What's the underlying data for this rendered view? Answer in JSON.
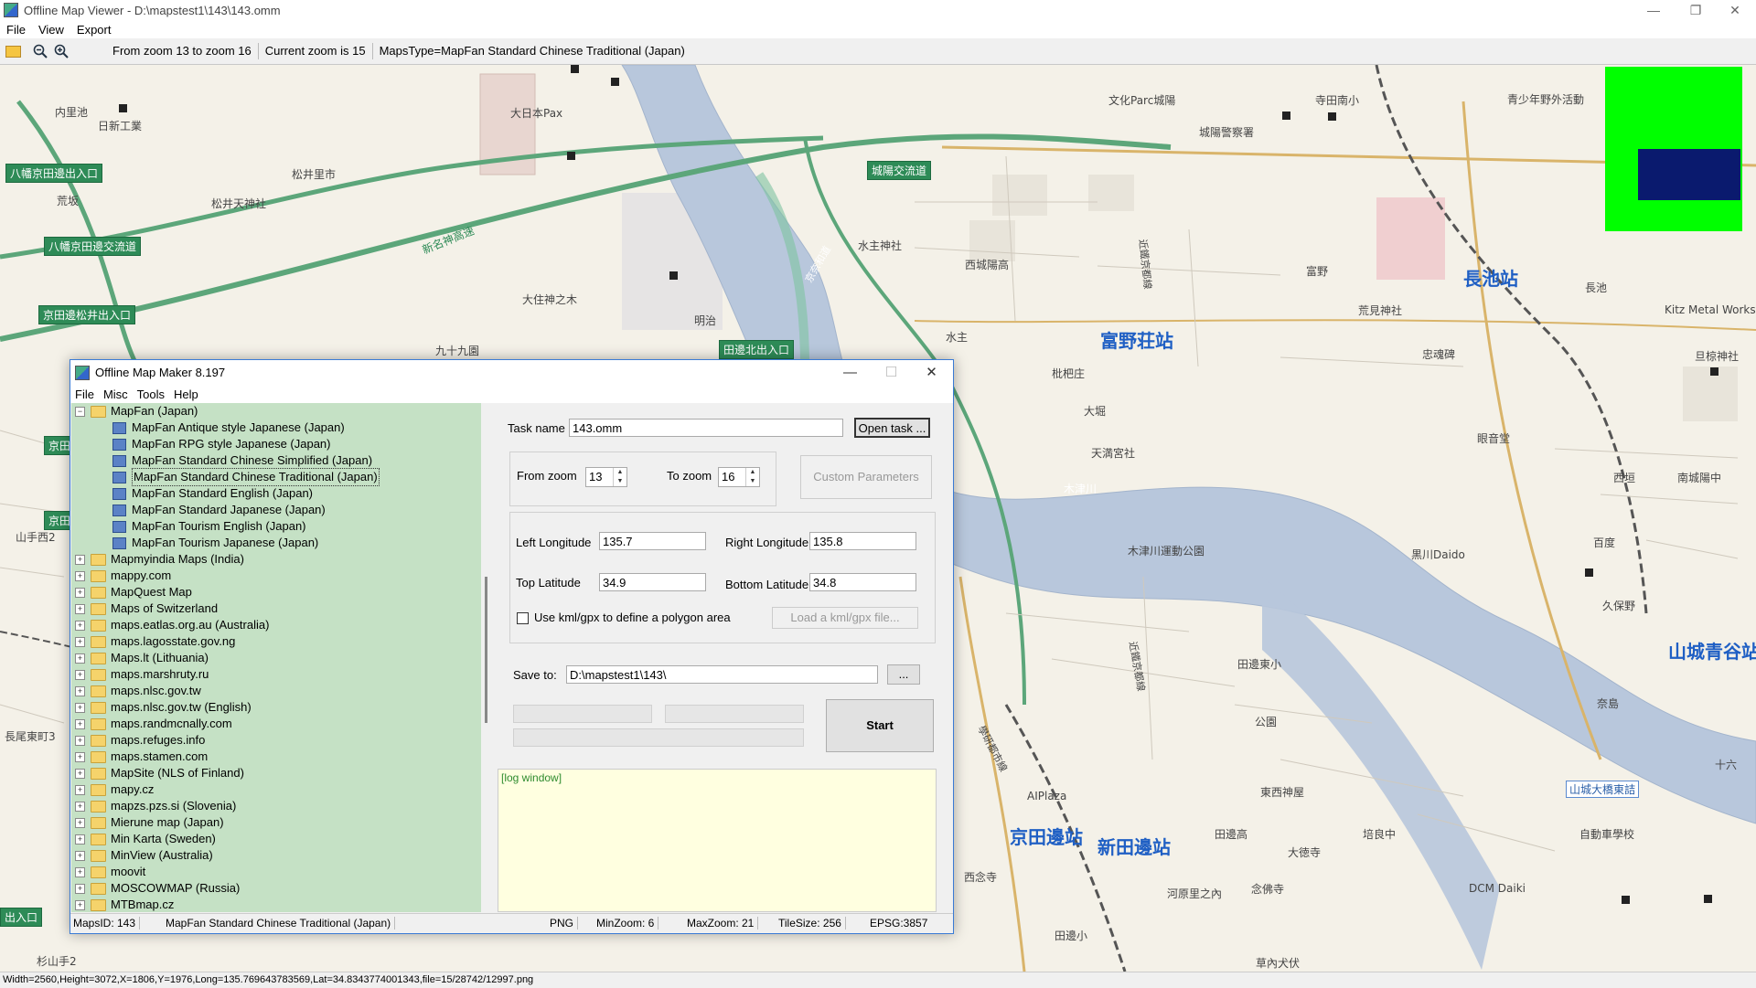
{
  "app": {
    "title": "Offline Map Viewer - D:\\mapstest1\\143\\143.omm",
    "menu": [
      "File",
      "View",
      "Export"
    ],
    "toolbar": {
      "zoom_range": "From zoom 13 to zoom 16",
      "current_zoom": "Current zoom is 15",
      "maps_type": "MapsType=MapFan Standard Chinese Traditional (Japan)"
    },
    "status": "Width=2560,Height=3072,X=1806,Y=1976,Long=135.769643783569,Lat=34.8343774001343,file=15/28742/12997.png"
  },
  "map_labels": [
    {
      "id": "l1",
      "text": "日新工業"
    },
    {
      "id": "l2",
      "text": "大日本Pax"
    },
    {
      "id": "l3",
      "text": "文化Parc城陽"
    },
    {
      "id": "l4",
      "text": "寺田南小"
    },
    {
      "id": "l5",
      "text": "青少年野外活動"
    },
    {
      "id": "l6",
      "text": "城陽警察署"
    },
    {
      "id": "l7",
      "text": "松井里市"
    },
    {
      "id": "l8",
      "text": "松井天神社"
    },
    {
      "id": "l9",
      "text": "新名神高速"
    },
    {
      "id": "l10",
      "text": "大住神之木"
    },
    {
      "id": "l11",
      "text": "明治"
    },
    {
      "id": "l12",
      "text": "九十九園"
    },
    {
      "id": "l13",
      "text": "水主神社"
    },
    {
      "id": "l14",
      "text": "西城陽高"
    },
    {
      "id": "l15",
      "text": "富野"
    },
    {
      "id": "l16",
      "text": "荒見神社"
    },
    {
      "id": "l17",
      "text": "長池"
    },
    {
      "id": "l18",
      "text": "Kitz Metal Works"
    },
    {
      "id": "l19",
      "text": "旦椋神社"
    },
    {
      "id": "l20",
      "text": "忠魂碑"
    },
    {
      "id": "l21",
      "text": "水主"
    },
    {
      "id": "l22",
      "text": "枇杷庄"
    },
    {
      "id": "l23",
      "text": "大堀"
    },
    {
      "id": "l24",
      "text": "天満宮社"
    },
    {
      "id": "l25",
      "text": "木津川"
    },
    {
      "id": "l26",
      "text": "西垣"
    },
    {
      "id": "l27",
      "text": "南城陽中"
    },
    {
      "id": "l28",
      "text": "木津川運動公園"
    },
    {
      "id": "l29",
      "text": "黒川Daido"
    },
    {
      "id": "l30",
      "text": "百度"
    },
    {
      "id": "l31",
      "text": "久保野"
    },
    {
      "id": "l32",
      "text": "田邊東小"
    },
    {
      "id": "l33",
      "text": "公園"
    },
    {
      "id": "l34",
      "text": "奈島"
    },
    {
      "id": "l35",
      "text": "AIPlaza"
    },
    {
      "id": "l36",
      "text": "東西神屋"
    },
    {
      "id": "l37",
      "text": "田邊高"
    },
    {
      "id": "l38",
      "text": "培良中"
    },
    {
      "id": "l39",
      "text": "自動車學校"
    },
    {
      "id": "l40",
      "text": "大徳寺"
    },
    {
      "id": "l41",
      "text": "西念寺"
    },
    {
      "id": "l42",
      "text": "河原里之內"
    },
    {
      "id": "l43",
      "text": "念佛寺"
    },
    {
      "id": "l44",
      "text": "DCM Daiki"
    },
    {
      "id": "l45",
      "text": "田邊小"
    },
    {
      "id": "l46",
      "text": "草內犬伏"
    },
    {
      "id": "l47",
      "text": "荒坂"
    },
    {
      "id": "l48",
      "text": "内里池"
    },
    {
      "id": "l49",
      "text": "山手西2"
    },
    {
      "id": "l50",
      "text": "長尾東町3"
    },
    {
      "id": "l51",
      "text": "杉山手2"
    },
    {
      "id": "l52",
      "text": "眼音堂"
    },
    {
      "id": "l53",
      "text": "十六"
    },
    {
      "id": "l54",
      "text": "近鐵京都線"
    },
    {
      "id": "l55",
      "text": "京奈和道"
    },
    {
      "id": "l56",
      "text": "學研都市線"
    },
    {
      "id": "l57",
      "text": "近鐵京都線"
    }
  ],
  "stations": [
    {
      "id": "s1",
      "text": "長池站"
    },
    {
      "id": "s2",
      "text": "富野荘站"
    },
    {
      "id": "s3",
      "text": "京田邊站"
    },
    {
      "id": "s4",
      "text": "新田邊站"
    },
    {
      "id": "s5",
      "text": "山城青谷站"
    }
  ],
  "road_labels": [
    {
      "id": "r1",
      "text": "八幡京田邊出入口"
    },
    {
      "id": "r2",
      "text": "八幡京田邊交流道"
    },
    {
      "id": "r3",
      "text": "京田邊松井出入口"
    },
    {
      "id": "r4",
      "text": "城陽交流道"
    },
    {
      "id": "r5",
      "text": "田邊北出入口"
    },
    {
      "id": "r6",
      "text": "京田"
    },
    {
      "id": "r7",
      "text": "京田"
    },
    {
      "id": "r8",
      "text": "出入口"
    }
  ],
  "blue_road_labels": [
    {
      "id": "b1",
      "text": "山城大橋東詰"
    }
  ],
  "dialog": {
    "title": "Offline Map Maker 8.197",
    "menu": [
      "File",
      "Misc",
      "Tools",
      "Help"
    ],
    "tree": {
      "expanded": "MapFan (Japan)",
      "children": [
        "MapFan Antique style Japanese (Japan)",
        "MapFan RPG style Japanese (Japan)",
        "MapFan Standard Chinese Simplified (Japan)",
        "MapFan Standard Chinese Traditional (Japan)",
        "MapFan Standard English (Japan)",
        "MapFan Standard Japanese (Japan)",
        "MapFan Tourism English (Japan)",
        "MapFan Tourism Japanese (Japan)"
      ],
      "selected": "MapFan Standard Chinese Traditional (Japan)",
      "folders": [
        "Mapmyindia Maps (India)",
        "mappy.com",
        "MapQuest Map",
        "Maps of Switzerland",
        "maps.eatlas.org.au (Australia)",
        "maps.lagosstate.gov.ng",
        "Maps.lt (Lithuania)",
        "maps.marshruty.ru",
        "maps.nlsc.gov.tw",
        "maps.nlsc.gov.tw (English)",
        "maps.randmcnally.com",
        "maps.refuges.info",
        "maps.stamen.com",
        "MapSite (NLS of Finland)",
        "mapy.cz",
        "mapzs.pzs.si (Slovenia)",
        "Mierune map (Japan)",
        "Min Karta (Sweden)",
        "MinView (Australia)",
        "moovit",
        "MOSCOWMAP (Russia)",
        "MTBmap.cz"
      ]
    },
    "task_name_label": "Task name",
    "task_name_value": "143.omm",
    "open_task": "Open task ...",
    "from_zoom_label": "From zoom",
    "from_zoom": "13",
    "to_zoom_label": "To zoom",
    "to_zoom": "16",
    "custom_params": "Custom Parameters",
    "left_lon_label": "Left Longitude",
    "left_lon": "135.7",
    "right_lon_label": "Right Longitude",
    "right_lon": "135.8",
    "top_lat_label": "Top Latitude",
    "top_lat": "34.9",
    "bottom_lat_label": "Bottom Latitude",
    "bottom_lat": "34.8",
    "kml_label": "Use kml/gpx to define a polygon area",
    "load_kml": "Load a kml/gpx file...",
    "save_to_label": "Save to:",
    "save_to": "D:\\mapstest1\\143\\",
    "browse": "...",
    "start": "Start",
    "log": "[log window]",
    "status": {
      "maps_id": "MapsID: 143",
      "maps_name": "MapFan Standard Chinese Traditional (Japan)",
      "format": "PNG",
      "min_zoom": "MinZoom: 6",
      "max_zoom": "MaxZoom: 21",
      "tile_size": "TileSize: 256",
      "epsg": "EPSG:3857"
    }
  },
  "colors": {
    "map_bg": "#f4f1e8",
    "river": "#b8c7dc",
    "greenbelt": "#9fd3b8",
    "tree_bg": "#c5e1c5",
    "log_bg": "#ffffe0",
    "station_text": "#1f5fc4",
    "overview_green": "#00ff00",
    "overview_navy": "#0a1a6e"
  }
}
